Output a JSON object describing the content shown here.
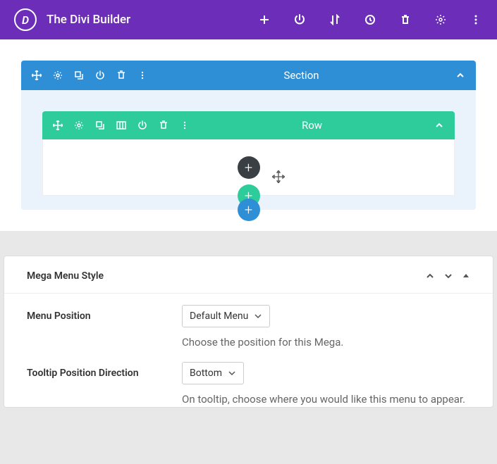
{
  "header": {
    "title": "The Divi Builder",
    "logo_letter": "D"
  },
  "section": {
    "label": "Section"
  },
  "row": {
    "label": "Row"
  },
  "settings": {
    "panel_title": "Mega Menu Style",
    "menu_position": {
      "label": "Menu Position",
      "value": "Default Menu",
      "help": "Choose the position for this Mega."
    },
    "tooltip_position": {
      "label": "Tooltip Position Direction",
      "value": "Bottom",
      "help": "On tooltip, choose where you would like this menu to appear."
    }
  }
}
